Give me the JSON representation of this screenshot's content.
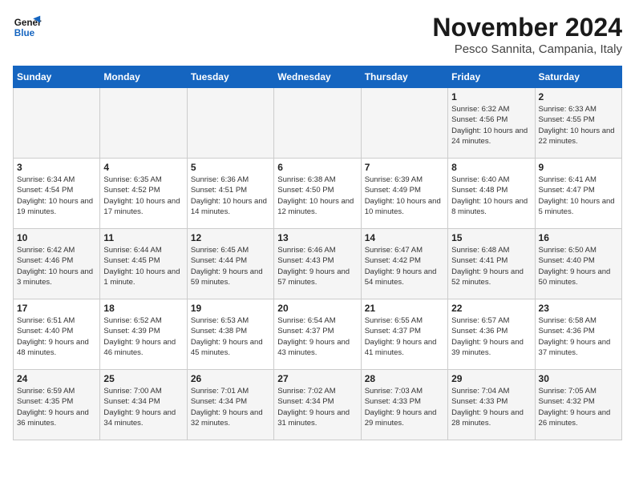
{
  "header": {
    "logo_line1": "General",
    "logo_line2": "Blue",
    "month_title": "November 2024",
    "location": "Pesco Sannita, Campania, Italy"
  },
  "days_of_week": [
    "Sunday",
    "Monday",
    "Tuesday",
    "Wednesday",
    "Thursday",
    "Friday",
    "Saturday"
  ],
  "weeks": [
    [
      {
        "day": "",
        "info": ""
      },
      {
        "day": "",
        "info": ""
      },
      {
        "day": "",
        "info": ""
      },
      {
        "day": "",
        "info": ""
      },
      {
        "day": "",
        "info": ""
      },
      {
        "day": "1",
        "info": "Sunrise: 6:32 AM\nSunset: 4:56 PM\nDaylight: 10 hours and 24 minutes."
      },
      {
        "day": "2",
        "info": "Sunrise: 6:33 AM\nSunset: 4:55 PM\nDaylight: 10 hours and 22 minutes."
      }
    ],
    [
      {
        "day": "3",
        "info": "Sunrise: 6:34 AM\nSunset: 4:54 PM\nDaylight: 10 hours and 19 minutes."
      },
      {
        "day": "4",
        "info": "Sunrise: 6:35 AM\nSunset: 4:52 PM\nDaylight: 10 hours and 17 minutes."
      },
      {
        "day": "5",
        "info": "Sunrise: 6:36 AM\nSunset: 4:51 PM\nDaylight: 10 hours and 14 minutes."
      },
      {
        "day": "6",
        "info": "Sunrise: 6:38 AM\nSunset: 4:50 PM\nDaylight: 10 hours and 12 minutes."
      },
      {
        "day": "7",
        "info": "Sunrise: 6:39 AM\nSunset: 4:49 PM\nDaylight: 10 hours and 10 minutes."
      },
      {
        "day": "8",
        "info": "Sunrise: 6:40 AM\nSunset: 4:48 PM\nDaylight: 10 hours and 8 minutes."
      },
      {
        "day": "9",
        "info": "Sunrise: 6:41 AM\nSunset: 4:47 PM\nDaylight: 10 hours and 5 minutes."
      }
    ],
    [
      {
        "day": "10",
        "info": "Sunrise: 6:42 AM\nSunset: 4:46 PM\nDaylight: 10 hours and 3 minutes."
      },
      {
        "day": "11",
        "info": "Sunrise: 6:44 AM\nSunset: 4:45 PM\nDaylight: 10 hours and 1 minute."
      },
      {
        "day": "12",
        "info": "Sunrise: 6:45 AM\nSunset: 4:44 PM\nDaylight: 9 hours and 59 minutes."
      },
      {
        "day": "13",
        "info": "Sunrise: 6:46 AM\nSunset: 4:43 PM\nDaylight: 9 hours and 57 minutes."
      },
      {
        "day": "14",
        "info": "Sunrise: 6:47 AM\nSunset: 4:42 PM\nDaylight: 9 hours and 54 minutes."
      },
      {
        "day": "15",
        "info": "Sunrise: 6:48 AM\nSunset: 4:41 PM\nDaylight: 9 hours and 52 minutes."
      },
      {
        "day": "16",
        "info": "Sunrise: 6:50 AM\nSunset: 4:40 PM\nDaylight: 9 hours and 50 minutes."
      }
    ],
    [
      {
        "day": "17",
        "info": "Sunrise: 6:51 AM\nSunset: 4:40 PM\nDaylight: 9 hours and 48 minutes."
      },
      {
        "day": "18",
        "info": "Sunrise: 6:52 AM\nSunset: 4:39 PM\nDaylight: 9 hours and 46 minutes."
      },
      {
        "day": "19",
        "info": "Sunrise: 6:53 AM\nSunset: 4:38 PM\nDaylight: 9 hours and 45 minutes."
      },
      {
        "day": "20",
        "info": "Sunrise: 6:54 AM\nSunset: 4:37 PM\nDaylight: 9 hours and 43 minutes."
      },
      {
        "day": "21",
        "info": "Sunrise: 6:55 AM\nSunset: 4:37 PM\nDaylight: 9 hours and 41 minutes."
      },
      {
        "day": "22",
        "info": "Sunrise: 6:57 AM\nSunset: 4:36 PM\nDaylight: 9 hours and 39 minutes."
      },
      {
        "day": "23",
        "info": "Sunrise: 6:58 AM\nSunset: 4:36 PM\nDaylight: 9 hours and 37 minutes."
      }
    ],
    [
      {
        "day": "24",
        "info": "Sunrise: 6:59 AM\nSunset: 4:35 PM\nDaylight: 9 hours and 36 minutes."
      },
      {
        "day": "25",
        "info": "Sunrise: 7:00 AM\nSunset: 4:34 PM\nDaylight: 9 hours and 34 minutes."
      },
      {
        "day": "26",
        "info": "Sunrise: 7:01 AM\nSunset: 4:34 PM\nDaylight: 9 hours and 32 minutes."
      },
      {
        "day": "27",
        "info": "Sunrise: 7:02 AM\nSunset: 4:34 PM\nDaylight: 9 hours and 31 minutes."
      },
      {
        "day": "28",
        "info": "Sunrise: 7:03 AM\nSunset: 4:33 PM\nDaylight: 9 hours and 29 minutes."
      },
      {
        "day": "29",
        "info": "Sunrise: 7:04 AM\nSunset: 4:33 PM\nDaylight: 9 hours and 28 minutes."
      },
      {
        "day": "30",
        "info": "Sunrise: 7:05 AM\nSunset: 4:32 PM\nDaylight: 9 hours and 26 minutes."
      }
    ]
  ]
}
